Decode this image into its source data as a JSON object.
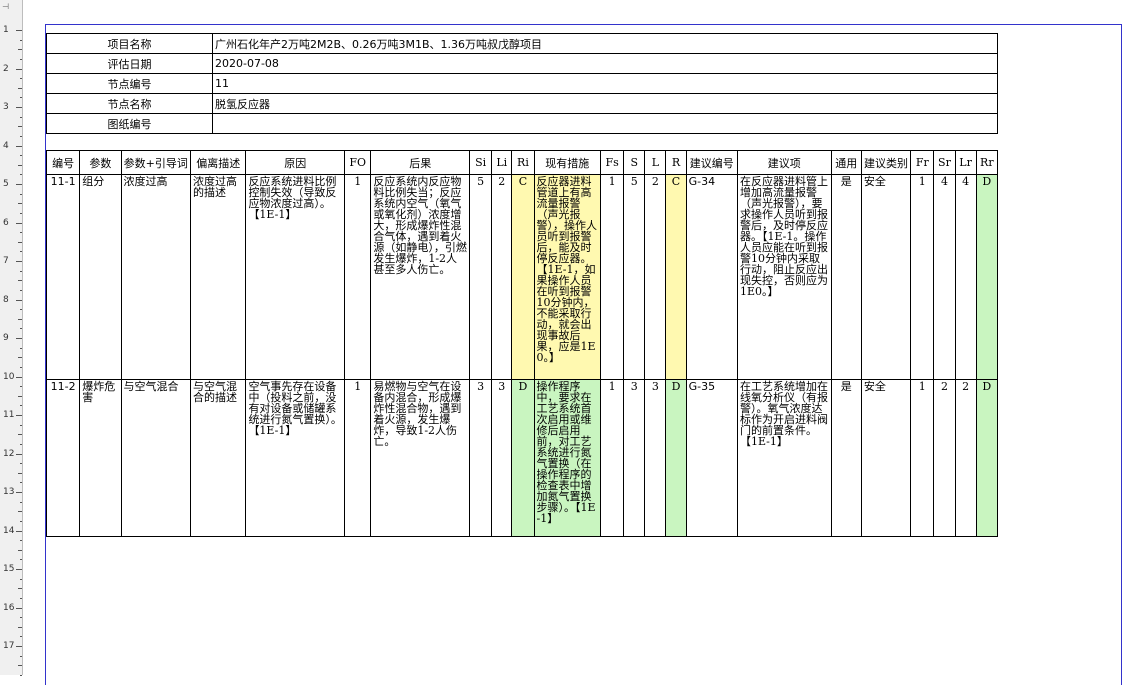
{
  "ruler": {
    "labels": [
      "1",
      "2",
      "3",
      "4",
      "5",
      "6",
      "7",
      "8",
      "9",
      "10",
      "11",
      "12",
      "13",
      "14",
      "15",
      "16",
      "17"
    ]
  },
  "info": {
    "rows": [
      {
        "label": "项目名称",
        "value": "广州石化年产2万吨2M2B、0.26万吨3M1B、1.36万吨叔戊醇项目"
      },
      {
        "label": "评估日期",
        "value": "2020-07-08"
      },
      {
        "label": "节点编号",
        "value": "11"
      },
      {
        "label": "节点名称",
        "value": "脱氢反应器"
      },
      {
        "label": "图纸编号",
        "value": ""
      }
    ]
  },
  "main": {
    "headers": [
      "编号",
      "参数",
      "参数+引导词",
      "偏离描述",
      "原因",
      "FO",
      "后果",
      "Si",
      "Li",
      "Ri",
      "现有措施",
      "Fs",
      "S",
      "L",
      "R",
      "建议编号",
      "建议项",
      "通用",
      "建议类别",
      "Fr",
      "Sr",
      "Lr",
      "Rr"
    ],
    "rows": [
      {
        "id": "11-1",
        "param": "组分",
        "guide": "浓度过高",
        "deviation": "浓度过高的描述",
        "cause": "反应系统进料比例控制失效（导致反应物浓度过高）。【1E-1】",
        "fo": "1",
        "consequence": "反应系统内反应物料比例失当；反应系统内空气（氧气或氧化剂）浓度增大，形成爆炸性混合气体，遇到着火源（如静电），引燃发生爆炸，1-2人甚至多人伤亡。",
        "si": "5",
        "li": "2",
        "ri": "C",
        "measures": "反应器进料管道上有高流量报警（声光报警），操作人员听到报警后，能及时停反应器。【1E-1，如果操作人员在听到报警10分钟内，不能采取行动，就会出现事故后果，应是1E0。】",
        "fs": "1",
        "s": "5",
        "l": "2",
        "r": "C",
        "rec_id": "G-34",
        "rec": "在反应器进料管上增加高流量报警（声光报警），要求操作人员听到报警后，及时停反应器。【1E-1。操作人员应能在听到报警10分钟内采取行动，阻止反应出现失控，否则应为1E0。】",
        "common": "是",
        "category": "安全",
        "fr": "1",
        "sr": "4",
        "lr": "4",
        "rr": "D"
      },
      {
        "id": "11-2",
        "param": "爆炸危害",
        "guide": "与空气混合",
        "deviation": "与空气混合的描述",
        "cause": "空气事先存在设备中（投料之前，没有对设备或储罐系统进行氮气置换）。【1E-1】",
        "fo": "1",
        "consequence": "易燃物与空气在设备内混合，形成爆炸性混合物，遇到着火源，发生爆炸，导致1-2人伤亡。",
        "si": "3",
        "li": "3",
        "ri": "D",
        "measures": "操作程序中，要求在工艺系统首次启用或维修后启用前，对工艺系统进行氮气置换（在操作程序的检查表中增加氮气置换步骤）。【1E-1】",
        "fs": "1",
        "s": "3",
        "l": "3",
        "r": "D",
        "rec_id": "G-35",
        "rec": "在工艺系统增加在线氧分析仪（有报警）。氧气浓度达标作为开启进料阀门的前置条件。【1E-1】",
        "common": "是",
        "category": "安全",
        "fr": "1",
        "sr": "2",
        "lr": "2",
        "rr": "D"
      }
    ]
  }
}
